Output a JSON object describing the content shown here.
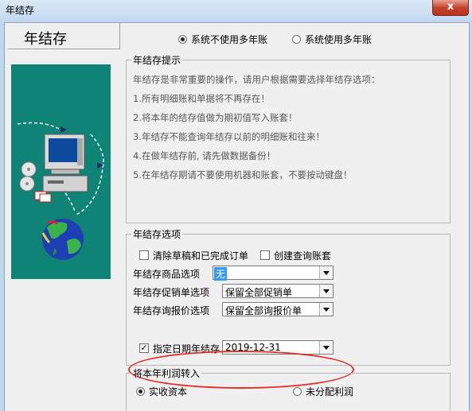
{
  "window": {
    "title": "年结存",
    "close_glyph": "x"
  },
  "heading": "年结存",
  "mode": {
    "options": [
      {
        "label": "系统不使用多年账",
        "selected": true
      },
      {
        "label": "系统使用多年账",
        "selected": false
      }
    ]
  },
  "tips": {
    "legend": "年结存提示",
    "lines": [
      "年结存是非常重要的操作，请用户根据需要选择年结存选项：",
      "1.所有明细账和单据将不再存在！",
      "2.将本年的结存值做为期初值写入账套！",
      "3.年结存不能查询年结存以前的明细账和往来！",
      "4.在做年结存前, 请先做数据备份！",
      "5.在年结存期请不要使用机器和账套，不要按动键盘！"
    ]
  },
  "options": {
    "legend": "年结存选项",
    "clear_drafts": {
      "label": "清除草稿和已完成订单",
      "checked": false
    },
    "create_query": {
      "label": "创建查询账套",
      "checked": false
    },
    "product_option": {
      "label": "年结存商品选项",
      "value": "无"
    },
    "promo_option": {
      "label": "年结存促销单选项",
      "value": "保留全部促销单"
    },
    "quote_option": {
      "label": "年结存询报价选项",
      "value": "保留全部询报价单"
    },
    "date_option": {
      "label": "指定日期年结存",
      "checked": true,
      "value": "2019-12-31"
    }
  },
  "profit": {
    "legend": "将本年利润转入",
    "options": [
      {
        "label": "实收资本",
        "selected": true
      },
      {
        "label": "未分配利润",
        "selected": false
      }
    ]
  },
  "colors": {
    "image_background": "#0f8476",
    "highlight_ellipse": "#e0312c",
    "selection": "#3399ff"
  }
}
